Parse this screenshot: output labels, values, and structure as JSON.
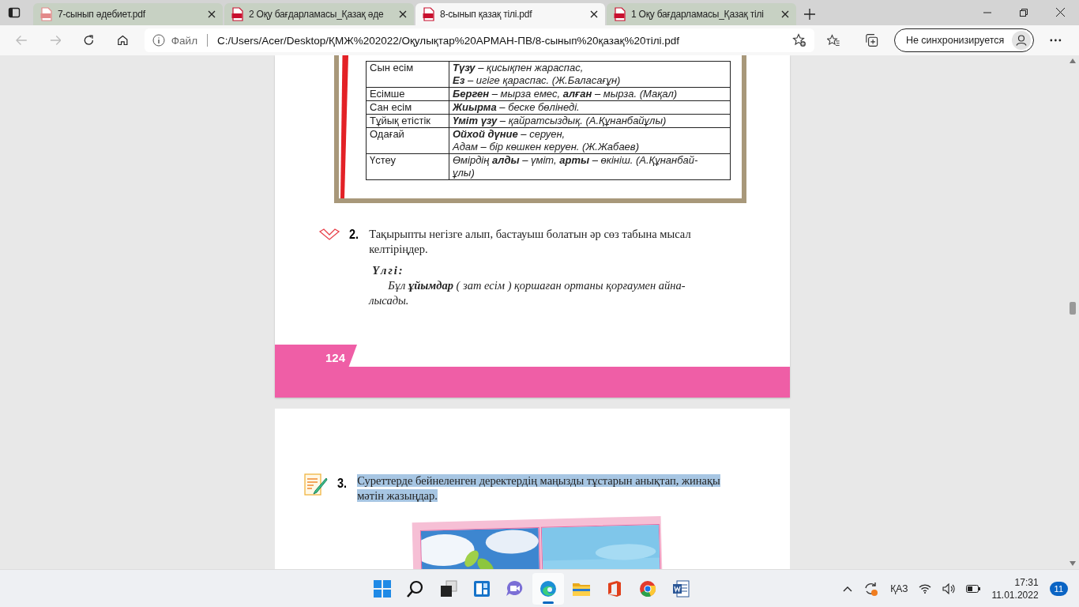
{
  "tabs": [
    {
      "title": "7-сынып әдебиет.pdf",
      "selected": false
    },
    {
      "title": "2 Оқу бағдарламасы_Қазақ әде",
      "selected": false
    },
    {
      "title": "8-сынып қазақ тілі.pdf",
      "selected": true
    },
    {
      "title": "1 Оқу бағдарламасы_Қазақ тілі",
      "selected": false
    }
  ],
  "address_bar": {
    "scheme_label": "Файл",
    "url": "C:/Users/Acer/Desktop/ҚМЖ%202022/Оқулықтар%20АРМАН-ПВ/8-сынып%20қазақ%20тілі.pdf"
  },
  "sync_button": "Не синхронизируется",
  "pages": [
    {
      "table": {
        "rows": [
          {
            "term": "Сын есім",
            "example": [
              "**Түзу** – қисықпен жараспас,",
              "**Ез** – игіге қараспас. (Ж.Баласағұн)"
            ]
          },
          {
            "term": "Есімше",
            "example": [
              "**Берген** – мырза емес, **алған** – мырза. (Мақал)"
            ]
          },
          {
            "term": "Сан есім",
            "example": [
              "**Жиырма** – беске бөлінеді."
            ]
          },
          {
            "term": "Тұйық етістік",
            "example": [
              "**Үміт үзу** – қайратсыздық. (А.Құнанбайұлы)"
            ]
          },
          {
            "term": "Одағай",
            "example": [
              "**Ойхой дүние** – серуен,",
              "Адам – бір көшкен керуен. (Ж.Жабаев)"
            ]
          },
          {
            "term": "Үстеу",
            "example": [
              "Өмірдің **алды** – үміт, **арты** – өкініш. (А.Құнанбай-",
              "ұлы)"
            ]
          }
        ]
      },
      "exercise": {
        "number": "2.",
        "text": "Тақырыпты негізге алып, бастауыш болатын әр сөз табына мысал келтіріңдер.",
        "example_label": "Үлгі:",
        "example_lines": [
          "Бұл **ұйымдар** ( зат есім ) қоршаған ортаны қорғаумен айна-",
          "лысады."
        ]
      },
      "page_number": "124"
    },
    {
      "exercise": {
        "number": "3.",
        "text": "Суреттерде бейнеленген деректердің маңызды тұстарын анықтап, жинақы мәтін жазыңдар.",
        "highlighted": true
      }
    }
  ],
  "taskbar": {
    "apps": [
      {
        "kind": "start",
        "active": false
      },
      {
        "kind": "search",
        "active": false
      },
      {
        "kind": "taskview",
        "active": false
      },
      {
        "kind": "widgets",
        "active": false
      },
      {
        "kind": "chat",
        "active": false
      },
      {
        "kind": "edge",
        "active": true
      },
      {
        "kind": "explorer",
        "active": false
      },
      {
        "kind": "office",
        "active": false
      },
      {
        "kind": "chrome",
        "active": false
      },
      {
        "kind": "word",
        "active": false
      }
    ],
    "language": "ҚАЗ",
    "time": "17:31",
    "date": "11.01.2022",
    "notifications": "11"
  }
}
